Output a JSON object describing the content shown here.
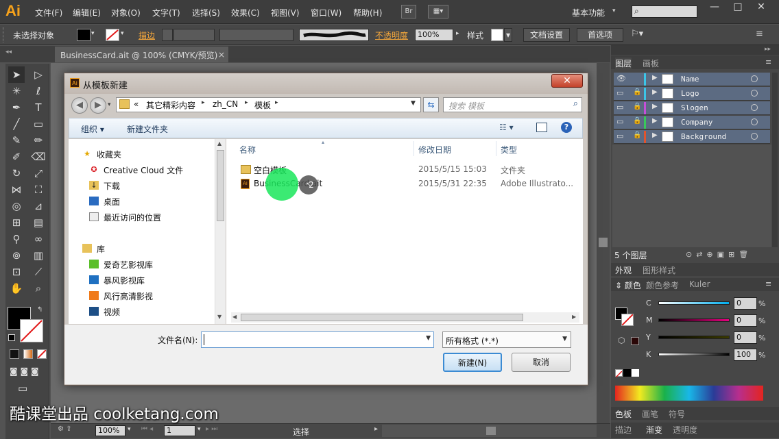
{
  "app": {
    "logo": "Ai",
    "menu": [
      "文件(F)",
      "编辑(E)",
      "对象(O)",
      "文字(T)",
      "选择(S)",
      "效果(C)",
      "视图(V)",
      "窗口(W)",
      "帮助(H)"
    ],
    "bridge_label": "Br",
    "workspace": "基本功能",
    "window_controls": [
      "—",
      "□",
      "✕"
    ]
  },
  "control_bar": {
    "no_selection": "未选择对象",
    "stroke_label": "描边",
    "opacity_label": "不透明度",
    "opacity_value": "100%",
    "style_label": "样式",
    "doc_settings": "文档设置",
    "preferences": "首选项"
  },
  "document_tab": {
    "title": "BusinessCard.ait @ 100% (CMYK/预览)",
    "close": "×"
  },
  "status_bar": {
    "zoom": "100%",
    "page": "1",
    "tool": "选择"
  },
  "layers_panel": {
    "tabs": [
      "图层",
      "画板"
    ],
    "layers": [
      {
        "name": "Name",
        "color": "#3cc5e8"
      },
      {
        "name": "Logo",
        "color": "#3cc5e8"
      },
      {
        "name": "Slogen",
        "color": "#c64fd8"
      },
      {
        "name": "Company",
        "color": "#38c95a"
      },
      {
        "name": "Background",
        "color": "#e0542e"
      }
    ],
    "count_label": "5 个图层"
  },
  "appearance_panel": {
    "tabs": [
      "外观",
      "图形样式"
    ]
  },
  "color_panel": {
    "tabs": [
      "颜色",
      "颜色参考",
      "Kuler"
    ],
    "channels": [
      {
        "label": "C",
        "value": "0",
        "unit": "%"
      },
      {
        "label": "M",
        "value": "0",
        "unit": "%"
      },
      {
        "label": "Y",
        "value": "0",
        "unit": "%"
      },
      {
        "label": "K",
        "value": "100",
        "unit": "%"
      }
    ]
  },
  "bottom_panels": {
    "tabs1": [
      "色板",
      "画笔",
      "符号"
    ],
    "tabs2": [
      "描边",
      "渐变",
      "透明度"
    ]
  },
  "dialog": {
    "title": "从模板新建",
    "breadcrumb": [
      "«",
      "其它精彩内容",
      "zh_CN",
      "模板"
    ],
    "search_placeholder": "搜索 模板",
    "toolbar": {
      "organize": "组织 ▾",
      "new_folder": "新建文件夹"
    },
    "nav": {
      "favorites_label": "收藏夹",
      "favorites": [
        "Creative Cloud 文件",
        "下载",
        "桌面",
        "最近访问的位置"
      ],
      "library_label": "库",
      "libraries": [
        "爱奇艺影视库",
        "暴风影视库",
        "风行高清影视",
        "视频"
      ]
    },
    "columns": {
      "name": "名称",
      "date": "修改日期",
      "type": "类型"
    },
    "files": [
      {
        "name": "空白模板",
        "date": "2015/5/15 15:03",
        "type": "文件夹",
        "icon": "folder-icon"
      },
      {
        "name": "BusinessCard.ait",
        "date": "2015/5/31 22:35",
        "type": "Adobe Illustrato...",
        "icon": "ai-file-icon"
      }
    ],
    "filename_label": "文件名(N):",
    "filename_value": "",
    "format_value": "所有格式 (*.*)",
    "new_button": "新建(N)",
    "cancel_button": "取消"
  },
  "cursor": {
    "click_count": "2"
  },
  "watermark": "酷课堂出品 coolketang.com"
}
